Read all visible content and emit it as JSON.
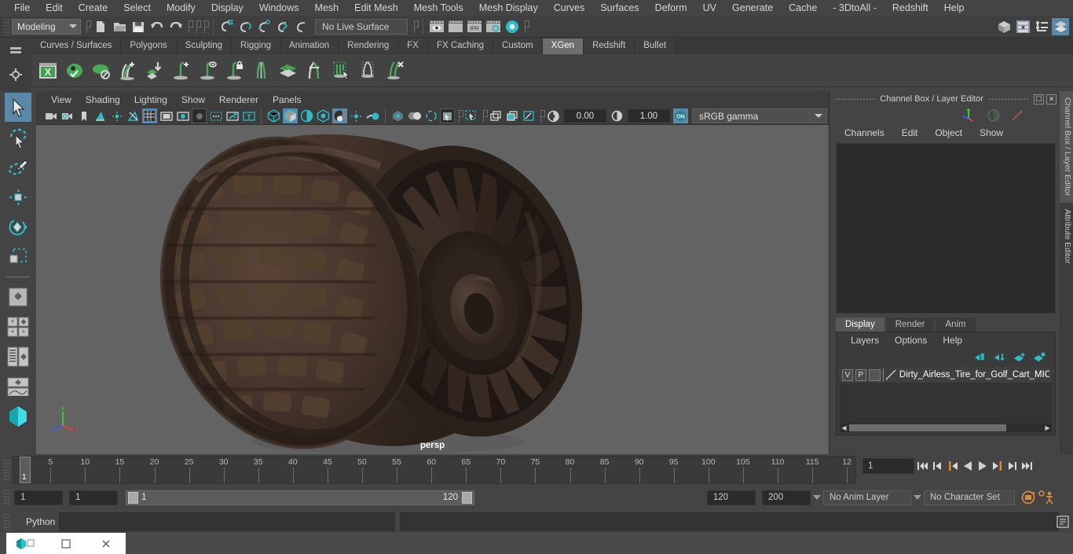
{
  "menubar": {
    "items": [
      "File",
      "Edit",
      "Create",
      "Select",
      "Modify",
      "Display",
      "Windows",
      "Mesh",
      "Edit Mesh",
      "Mesh Tools",
      "Mesh Display",
      "Curves",
      "Surfaces",
      "Deform",
      "UV",
      "Generate",
      "Cache",
      "- 3DtoAll -",
      "Redshift",
      "Help"
    ]
  },
  "statusbar": {
    "mode": "Modeling",
    "live_surface": "No Live Surface",
    "icons": [
      "new-scene-icon",
      "open-scene-icon",
      "save-scene-icon",
      "undo-icon",
      "redo-icon",
      "select-by-hierarchy-icon",
      "select-by-object-icon",
      "select-by-component-icon",
      "snap-to-grid-icon",
      "snap-to-curve-icon",
      "snap-to-point-icon",
      "snap-to-projected-center-icon",
      "render-view-icon",
      "render-sequence-icon",
      "ipr-render-icon",
      "render-settings-icon",
      "hypershade-icon"
    ],
    "right_icons": [
      "show-hide-modeling-toolkit-icon",
      "show-hide-attribute-editor-icon",
      "show-hide-tool-settings-icon",
      "show-hide-channel-box-icon"
    ]
  },
  "shelf": {
    "tabs": [
      "Curves / Surfaces",
      "Polygons",
      "Sculpting",
      "Rigging",
      "Animation",
      "Rendering",
      "FX",
      "FX Caching",
      "Custom",
      "XGen",
      "Redshift",
      "Bullet"
    ],
    "active_tab": "XGen",
    "icons": [
      "xgen-editor-icon",
      "xgen-preview-icon",
      "xgen-disable-preview-icon",
      "xgen-add-description-icon",
      "xgen-import-collection-icon",
      "xgen-add-primitive-icon",
      "xgen-preview-primitive-icon",
      "xgen-lock-primitive-icon",
      "xgen-split-primitive-icon",
      "xgen-density-map-icon",
      "xgen-grooming-icon",
      "xgen-select-guides-icon",
      "xgen-clump-icon",
      "xgen-delete-guides-icon"
    ]
  },
  "viewport": {
    "menus": [
      "View",
      "Shading",
      "Lighting",
      "Show",
      "Renderer",
      "Panels"
    ],
    "camera_label": "persp",
    "exposure": "0.00",
    "gamma_value": "1.00",
    "color_management": "sRGB gamma",
    "gamma_toggle": "ON",
    "axis_labels": {
      "x": "x",
      "y": "y",
      "z": "z"
    },
    "axis_colors": {
      "x": "#ee3b3b",
      "y": "#33cc33",
      "z": "#3b5cee"
    },
    "toolbar_icons": [
      "select-camera-icon",
      "camera-attributes-icon",
      "bookmark-icon",
      "image-plane-icon",
      "two-sided-lighting-icon",
      "shadows-icon",
      "grid-icon",
      "film-gate-icon",
      "resolution-gate-icon",
      "gate-mask-icon",
      "xray-icon",
      "xray-joints-icon",
      "texture-borders-icon",
      "wireframe-icon",
      "smooth-shade-all-icon",
      "smooth-shade-textured-icon",
      "use-all-lights-icon",
      "shadows-toggle-icon",
      "screen-space-ao-icon",
      "motion-blur-icon",
      "multisample-icon",
      "depth-of-field-icon",
      "isolate-select-icon",
      "select-mask-icon",
      "xray-duplicate-icon",
      "xray-component-icon",
      "grease-pencil-icon",
      "exposure-icon",
      "gamma-icon",
      "color-management-icon"
    ]
  },
  "channelbox": {
    "title": "Channel Box / Layer Editor",
    "menus": [
      "Channels",
      "Edit",
      "Object",
      "Show"
    ],
    "header_icons": [
      "manipulator-axis-icon",
      "channel-sphere-icon",
      "channel-slash-icon"
    ],
    "window_buttons": [
      "undock-icon",
      "close-icon"
    ],
    "vertical_tabs": [
      "Channel Box / Layer Editor",
      "Attribute Editor"
    ],
    "active_vertical_tab": "Channel Box / Layer Editor"
  },
  "layer_editor": {
    "tabs": [
      "Display",
      "Render",
      "Anim"
    ],
    "active_tab": "Display",
    "menus": [
      "Layers",
      "Options",
      "Help"
    ],
    "buttons": [
      "move-layer-up-icon",
      "move-layer-down-icon",
      "new-layer-icon",
      "new-layer-from-selected-icon"
    ],
    "layers": [
      {
        "visibility": "V",
        "playback": "P",
        "color": "",
        "name": "Dirty_Airless_Tire_for_Golf_Cart_MICHE"
      }
    ]
  },
  "timeline": {
    "ticks": [
      5,
      10,
      15,
      20,
      25,
      30,
      35,
      40,
      45,
      50,
      55,
      60,
      65,
      70,
      75,
      80,
      85,
      90,
      95,
      100,
      105,
      110,
      115
    ],
    "last_partial_label": "12",
    "current_frame_marker": "1",
    "current_frame": "1",
    "playback_buttons": [
      "go-to-start-icon",
      "step-back-keyframe-icon",
      "step-back-frame-icon",
      "play-backwards-icon",
      "play-forwards-icon",
      "step-forward-frame-icon",
      "step-forward-keyframe-icon",
      "go-to-end-icon"
    ]
  },
  "range": {
    "anim_start": "1",
    "range_start": "1",
    "slider_start_label": "1",
    "slider_end_label": "120",
    "range_end": "120",
    "anim_end": "200",
    "anim_layer": "No Anim Layer",
    "character_set": "No Character Set",
    "right_icons": [
      "auto-keyframe-icon",
      "animation-preferences-icon"
    ]
  },
  "command_line": {
    "language": "Python",
    "input_value": "",
    "result_value": "",
    "script_editor_icon": "script-editor-icon"
  },
  "toolbox": {
    "items": [
      {
        "name": "select-tool",
        "selected": true
      },
      {
        "name": "lasso-select-tool",
        "selected": false
      },
      {
        "name": "paint-select-tool",
        "selected": false
      },
      {
        "name": "move-tool",
        "selected": false
      },
      {
        "name": "rotate-tool",
        "selected": false
      },
      {
        "name": "scale-tool",
        "selected": false
      },
      {
        "name": "last-tool-used",
        "selected": false
      },
      {
        "name": "single-perspective-view-layout",
        "selected": false
      },
      {
        "name": "four-view-layout",
        "selected": false
      },
      {
        "name": "outliner-persp-layout",
        "selected": false
      },
      {
        "name": "persp-graph-layout",
        "selected": false
      },
      {
        "name": "maya-logo-icon",
        "selected": false
      }
    ]
  },
  "taskbar": {
    "buttons": [
      "app-icon",
      "restore-window-icon",
      "close-window-icon"
    ]
  }
}
